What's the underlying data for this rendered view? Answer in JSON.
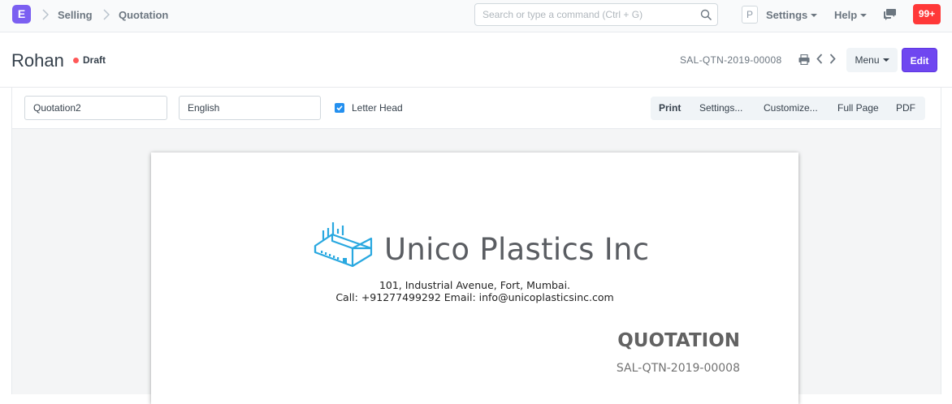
{
  "navbar": {
    "logo_letter": "E",
    "breadcrumbs": [
      "Selling",
      "Quotation"
    ],
    "search_placeholder": "Search or type a command (Ctrl + G)",
    "avatar_letter": "P",
    "settings_label": "Settings",
    "help_label": "Help",
    "notification_count": "99+"
  },
  "header": {
    "title": "Rohan",
    "status": "Draft",
    "status_color": "#ff5858",
    "doc_name": "SAL-QTN-2019-00008",
    "menu_label": "Menu",
    "edit_label": "Edit"
  },
  "toolbar": {
    "print_format": "Quotation2",
    "language": "English",
    "letter_head_label": "Letter Head",
    "letter_head_checked": true,
    "buttons": [
      "Print",
      "Settings...",
      "Customize...",
      "Full Page",
      "PDF"
    ]
  },
  "document": {
    "company_name": "Unico Plastics Inc",
    "address_line": "101, Industrial Avenue, Fort, Mumbai.",
    "contact_line": "Call: +91277499292 Email: info@unicoplasticsinc.com",
    "heading": "QUOTATION",
    "number": "SAL-QTN-2019-00008",
    "logo_icon": "factory-icon",
    "logo_color": "#29a8e0"
  },
  "colors": {
    "brand": "#7b5ff1",
    "edit_button": "#6f47f0",
    "badge": "#ff3838",
    "checkbox": "#2490ef"
  }
}
